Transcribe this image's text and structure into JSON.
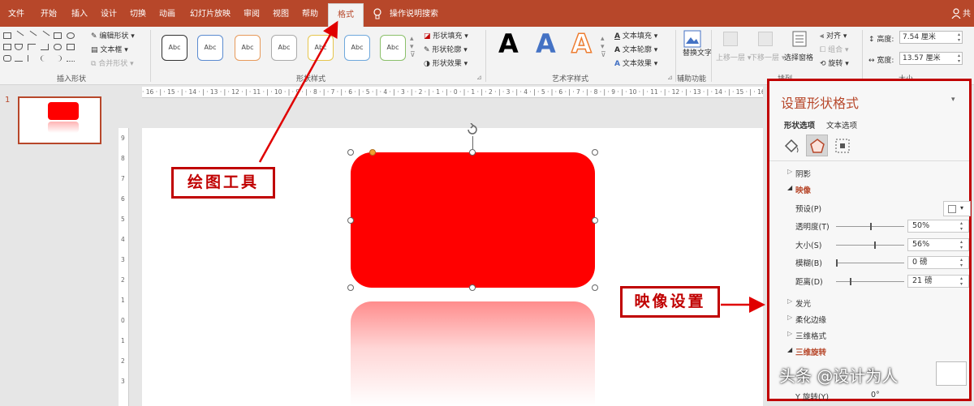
{
  "tabs": [
    "文件",
    "开始",
    "插入",
    "设计",
    "切换",
    "动画",
    "幻灯片放映",
    "审阅",
    "视图",
    "帮助",
    "格式"
  ],
  "tell_me": "操作说明搜索",
  "share": "共",
  "ribbon": {
    "insert_shapes": {
      "label": "插入形状",
      "edit_shape": "编辑形状",
      "textbox": "文本框",
      "merge_shapes": "合并形状"
    },
    "shape_styles": {
      "label": "形状样式",
      "preset_text": "Abc",
      "fill": "形状填充",
      "outline": "形状轮廓",
      "effects": "形状效果"
    },
    "wordart": {
      "label": "艺术字样式",
      "sample": "A",
      "text_fill": "文本填充",
      "text_outline": "文本轮廓",
      "text_effects": "文本效果"
    },
    "accessibility": {
      "label": "辅助功能",
      "alt_text": "替换文字"
    },
    "arrange": {
      "label": "排列",
      "bring_forward": "上移一层",
      "send_backward": "下移一层",
      "selection_pane": "选择窗格",
      "align": "对齐",
      "group": "组合",
      "rotate": "旋转"
    },
    "size": {
      "label": "大小",
      "height_label": "高度:",
      "height_value": "7.54 厘米",
      "width_label": "宽度:",
      "width_value": "13.57 厘米"
    }
  },
  "thumbnail": {
    "number": "1"
  },
  "ruler": {
    "horizontal": "· 16 · | · 15 · | · 14 · | · 13 · | · 12 · | · 11 · | · 10 · | · 9 · | · 8 · | · 7 · | · 6 · | · 5 · | · 4 · | · 3 · | · 2 · | · 1 · | · 0 · | · 1 · | · 2 · | · 3 · | · 4 · | · 5 · | · 6 · | · 7 · | · 8 · | · 9 · | · 10 · | · 11 · | · 12 · | · 13 · | · 14 · | · 15 · | · 16 ·",
    "vertical": [
      "9",
      "8",
      "7",
      "6",
      "5",
      "4",
      "3",
      "2",
      "1",
      "0",
      "1",
      "2",
      "3"
    ]
  },
  "format_pane": {
    "title": "设置形状格式",
    "tab_shape": "形状选项",
    "tab_text": "文本选项",
    "sections": {
      "shadow": "阴影",
      "reflection": "映像",
      "glow": "发光",
      "soft_edges": "柔化边缘",
      "format_3d": "三维格式",
      "rotation_3d": "三维旋转"
    },
    "preset_label": "预设(P)",
    "props": [
      {
        "label": "透明度(T)",
        "value": "50%",
        "level": 0.5
      },
      {
        "label": "大小(S)",
        "value": "56%",
        "level": 0.56
      },
      {
        "label": "模糊(B)",
        "value": "0 磅",
        "level": 0
      },
      {
        "label": "距离(D)",
        "value": "21 磅",
        "level": 0.2
      }
    ],
    "partial_1": "Y 旋转(Y)",
    "partial_2": "0°"
  },
  "callouts": {
    "drawing_tools": "绘图工具",
    "reflection_settings": "映像设置"
  },
  "watermark": "头条 @设计为人",
  "colors": {
    "accent": "#b7472a",
    "shape": "#ff0000",
    "callout": "#c00000"
  }
}
